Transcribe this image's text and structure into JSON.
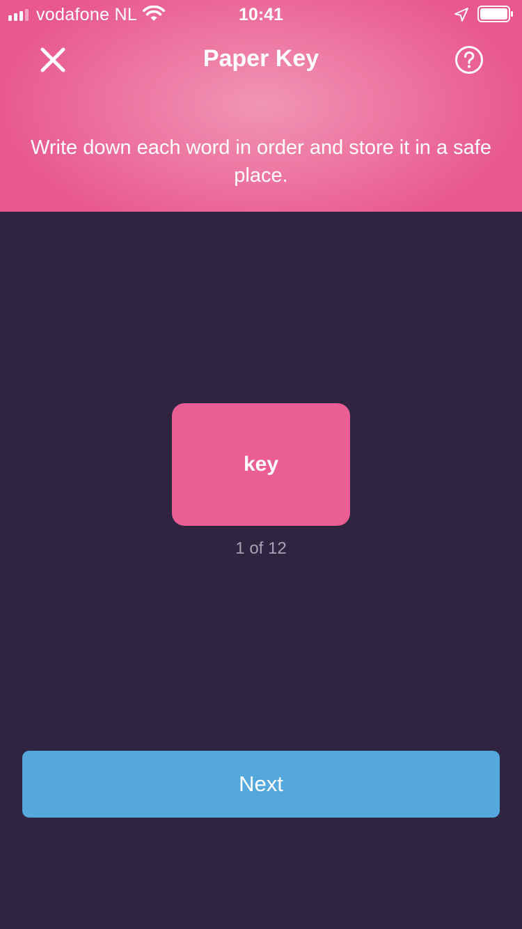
{
  "status_bar": {
    "carrier": "vodafone NL",
    "time": "10:41",
    "icons": [
      "signal-icon",
      "wifi-icon",
      "location-arrow-icon",
      "battery-icon"
    ]
  },
  "nav": {
    "title": "Paper Key",
    "close_icon": "close-icon",
    "help_icon": "help-icon"
  },
  "instructions": "Write down each word in order and store it in a safe place.",
  "word_card": {
    "word": "key",
    "counter": "1 of 12"
  },
  "actions": {
    "next_label": "Next"
  },
  "colors": {
    "header_pink": "#e8588f",
    "card_pink": "#ea5e93",
    "background": "#2f2541",
    "button_blue": "#55a8dc",
    "counter_text": "#a7a2b2"
  }
}
